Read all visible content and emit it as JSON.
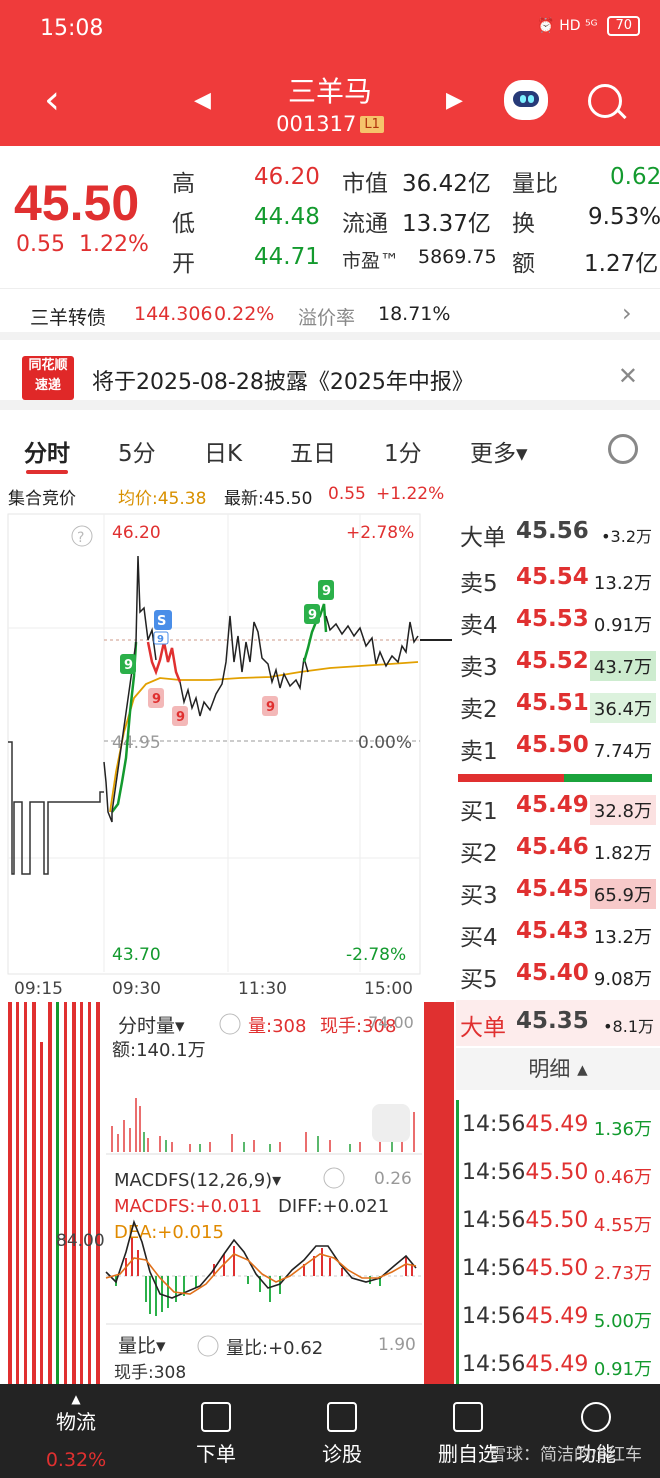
{
  "status": {
    "time": "15:08",
    "icons": "⏰ HD ⁵ᴳ",
    "battery": "70"
  },
  "header": {
    "title": "三羊马",
    "code": "001317",
    "level": "L1",
    "colors": {
      "bg": "#ef3b3b"
    }
  },
  "quote": {
    "price": "45.50",
    "change": "0.55",
    "change_pct": "1.22%",
    "high_label": "高",
    "high": "46.20",
    "low_label": "低",
    "low": "44.48",
    "open_label": "开",
    "open": "44.71",
    "mktcap_label": "市值",
    "mktcap": "36.42亿",
    "float_label": "流通",
    "float": "13.37亿",
    "pe_label": "市盈™",
    "pe": "5869.75",
    "volratio_label": "量比",
    "volratio": "0.62",
    "turnover_label": "换",
    "turnover": "9.53%",
    "amount_label": "额",
    "amount": "1.27亿"
  },
  "bond": {
    "name": "三羊转债",
    "price": "144.306",
    "pct": "0.22%",
    "premium_label": "溢价率",
    "premium": "18.71%"
  },
  "news": {
    "logo_top": "同花顺",
    "logo_bottom": "速递",
    "text": "将于2025-08-28披露《2025年中报》"
  },
  "tabs": [
    "分时",
    "5分",
    "日K",
    "五日",
    "1分",
    "更多▾"
  ],
  "infoline": {
    "auction": "集合竞价",
    "avg": "均价:45.38",
    "latest": "最新:45.50",
    "chg": "0.55",
    "pct": "+1.22%"
  },
  "chart": {
    "top_price": "46.20",
    "top_pct": "+2.78%",
    "mid_price": "44.95",
    "mid_pct": "0.00%",
    "bottom_price": "43.70",
    "bottom_pct": "-2.78%",
    "times": [
      "09:15",
      "09:30",
      "11:30",
      "15:00"
    ],
    "markers": [
      "9",
      "9",
      "9",
      "9",
      "9",
      "9",
      "S",
      "9"
    ],
    "vol_tab": "分时量▾",
    "vol": "量:308",
    "cur": "现手:308",
    "vol_amount": "额:140.1万",
    "vol_top": "74.00",
    "left_vol_label": "84.00",
    "macd_tab": "MACDFS(12,26,9)▾",
    "macd_top": "0.26",
    "macd_val": "MACDFS:+0.011",
    "diff": "DIFF:+0.021",
    "dea": "DEA:+0.015",
    "ratio_tab": "量比▾",
    "ratio_val": "量比:+0.62",
    "ratio_top": "1.90",
    "ratio_cur": "现手:308"
  },
  "orderbook": {
    "big_top_label": "大单",
    "big_top_price": "45.56",
    "big_top_vol": "•3.2万",
    "asks": [
      {
        "label": "卖5",
        "price": "45.54",
        "vol": "13.2万"
      },
      {
        "label": "卖4",
        "price": "45.53",
        "vol": "0.91万"
      },
      {
        "label": "卖3",
        "price": "45.52",
        "vol": "43.7万"
      },
      {
        "label": "卖2",
        "price": "45.51",
        "vol": "36.4万"
      },
      {
        "label": "卖1",
        "price": "45.50",
        "vol": "7.74万"
      }
    ],
    "bids": [
      {
        "label": "买1",
        "price": "45.49",
        "vol": "32.8万"
      },
      {
        "label": "买2",
        "price": "45.46",
        "vol": "1.82万"
      },
      {
        "label": "买3",
        "price": "45.45",
        "vol": "65.9万"
      },
      {
        "label": "买4",
        "price": "45.43",
        "vol": "13.2万"
      },
      {
        "label": "买5",
        "price": "45.40",
        "vol": "9.08万"
      }
    ],
    "big_bottom_label": "大单",
    "big_bottom_price": "45.35",
    "big_bottom_vol": "•8.1万"
  },
  "tape": {
    "title": "明细 ▴",
    "rows": [
      {
        "time": "14:56",
        "price": "45.49",
        "vol": "1.36万"
      },
      {
        "time": "14:56",
        "price": "45.50",
        "vol": "0.46万"
      },
      {
        "time": "14:56",
        "price": "45.50",
        "vol": "4.55万"
      },
      {
        "time": "14:56",
        "price": "45.50",
        "vol": "2.73万"
      },
      {
        "time": "14:56",
        "price": "45.49",
        "vol": "5.00万"
      },
      {
        "time": "14:56",
        "price": "45.49",
        "vol": "0.91万"
      }
    ]
  },
  "bottomnav": {
    "items": [
      "物流",
      "下单",
      "诊股",
      "删自选",
      "功能"
    ],
    "logistics_pct": "0.32%",
    "watermark": "雪球：简洁的小红车"
  }
}
